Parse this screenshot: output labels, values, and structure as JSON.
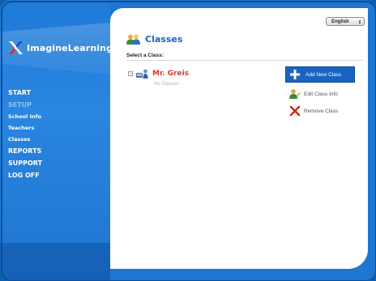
{
  "brand": {
    "logo_text": "ImagineLearning"
  },
  "nav": {
    "items": [
      {
        "label": "START",
        "style": "main"
      },
      {
        "label": "SETUP",
        "style": "dim"
      },
      {
        "label": "School Info",
        "style": "sub"
      },
      {
        "label": "Teachers",
        "style": "sub"
      },
      {
        "label": "Classes",
        "style": "sub"
      },
      {
        "label": "REPORTS",
        "style": "main"
      },
      {
        "label": "SUPPORT",
        "style": "main"
      },
      {
        "label": "LOG OFF",
        "style": "main"
      }
    ]
  },
  "header": {
    "language": "English",
    "title": "Classes",
    "subtitle": "Select a Class:"
  },
  "tree": {
    "teacher_name": "Mr. Greis",
    "empty_text": "No Classes"
  },
  "actions": {
    "add_label": "Add New Class",
    "edit_label": "Edit Class Info",
    "remove_label": "Remove Class"
  },
  "colors": {
    "sidebar": "#1e76d2",
    "title_blue": "#1565c8",
    "teacher_red": "#d73a2e",
    "button_blue": "#1a63c0"
  }
}
